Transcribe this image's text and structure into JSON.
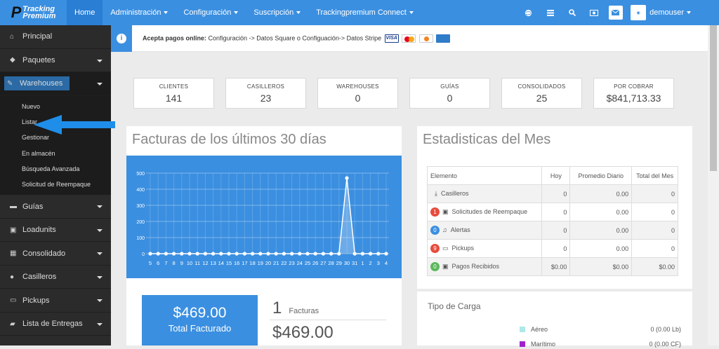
{
  "brand": {
    "line1": "Tracking",
    "line2": "Premium"
  },
  "nav": {
    "items": [
      {
        "label": "Home",
        "active": true,
        "caret": false
      },
      {
        "label": "Administración",
        "caret": true
      },
      {
        "label": "Configuración",
        "caret": true
      },
      {
        "label": "Suscripción",
        "caret": true
      },
      {
        "label": "Trackingpremium Connect",
        "caret": true
      }
    ],
    "icons": [
      "globe-icon",
      "list-icon",
      "search-icon",
      "money-icon",
      "mail-icon"
    ],
    "user": "demouser"
  },
  "sidebar": {
    "items": [
      {
        "label": "Principal",
        "icon": "home-icon",
        "glyph": "⌂",
        "arrow": false
      },
      {
        "label": "Paquetes",
        "icon": "tag-icon",
        "glyph": "◆",
        "arrow": true
      },
      {
        "label": "Warehouses",
        "icon": "edit-icon",
        "glyph": "✎",
        "arrow": true,
        "open": true
      },
      {
        "label": "Guías",
        "icon": "card-icon",
        "glyph": "▬",
        "arrow": true
      },
      {
        "label": "Loadunits",
        "icon": "box-icon",
        "glyph": "▣",
        "arrow": true
      },
      {
        "label": "Consolidado",
        "icon": "table-icon",
        "glyph": "▦",
        "arrow": true
      },
      {
        "label": "Casilleros",
        "icon": "pin-icon",
        "glyph": "●",
        "arrow": true
      },
      {
        "label": "Pickups",
        "icon": "car-icon",
        "glyph": "▭",
        "arrow": true
      },
      {
        "label": "Lista de Entregas",
        "icon": "truck-icon",
        "glyph": "▰",
        "arrow": true
      }
    ],
    "submenu": [
      "Nuevo",
      "Listar",
      "Gestionar",
      "En almacén",
      "Búsqueda Avanzada",
      "Solicitud de Reempaque"
    ]
  },
  "alert": {
    "bold": "Acepta pagos online:",
    "text": " Configuración -> Datos Square o Configuación-> Datos Stripe"
  },
  "stats": [
    {
      "label": "CLIENTES",
      "value": "141"
    },
    {
      "label": "CASILLEROS",
      "value": "23"
    },
    {
      "label": "WAREHOUSES",
      "value": "0"
    },
    {
      "label": "GUÍAS",
      "value": "0"
    },
    {
      "label": "CONSOLIDADOS",
      "value": "25"
    },
    {
      "label": "POR COBRAR",
      "value": "$841,713.33"
    }
  ],
  "invoices": {
    "title": "Facturas de los últimos 30 días",
    "total_amount": "$469.00",
    "total_label": "Total Facturado",
    "count": "1",
    "count_label": "Facturas",
    "amount": "$469.00"
  },
  "chart_data": {
    "type": "line",
    "categories": [
      "5",
      "6",
      "7",
      "8",
      "9",
      "10",
      "11",
      "12",
      "13",
      "14",
      "15",
      "16",
      "17",
      "18",
      "19",
      "20",
      "21",
      "22",
      "23",
      "24",
      "25",
      "26",
      "27",
      "28",
      "29",
      "30",
      "31",
      "1",
      "2",
      "3",
      "4"
    ],
    "values": [
      0,
      0,
      0,
      0,
      0,
      0,
      0,
      0,
      0,
      0,
      0,
      0,
      0,
      0,
      0,
      0,
      0,
      0,
      0,
      0,
      0,
      0,
      0,
      0,
      0,
      469,
      0,
      0,
      0,
      0,
      0
    ],
    "yticks": [
      0,
      100,
      200,
      300,
      400,
      500
    ],
    "ylim": [
      0,
      500
    ],
    "grid": true,
    "colors": {
      "background": "#3b8fe0",
      "line": "#ffffff"
    }
  },
  "stats_month": {
    "title": "Estadisticas del Mes",
    "headers": [
      "Elemento",
      "Hoy",
      "Promedio Diario",
      "Total del Mes"
    ],
    "rows": [
      {
        "label": "Casilleros",
        "badge": "",
        "badge_color": "",
        "icon": "download-icon",
        "glyph": "⤓",
        "hoy": "0",
        "prom": "0.00",
        "total": "0"
      },
      {
        "label": "Solicitudes de Reempaque",
        "badge": "1",
        "badge_color": "#e74c3c",
        "icon": "box-icon",
        "glyph": "▣",
        "hoy": "0",
        "prom": "0.00",
        "total": "0"
      },
      {
        "label": "Alertas",
        "badge": "0",
        "badge_color": "#3b8fe0",
        "icon": "bell-icon",
        "glyph": "♫",
        "hoy": "0",
        "prom": "0.00",
        "total": "0"
      },
      {
        "label": "Pickups",
        "badge": "9",
        "badge_color": "#e74c3c",
        "icon": "car-icon",
        "glyph": "▭",
        "hoy": "0",
        "prom": "0.00",
        "total": "0"
      },
      {
        "label": "Pagos Recibidos",
        "badge": "0",
        "badge_color": "#5cb85c",
        "icon": "money-icon",
        "glyph": "▣",
        "hoy": "$0.00",
        "prom": "$0.00",
        "total": "$0.00"
      }
    ]
  },
  "cargo": {
    "title": "Tipo de Carga",
    "items": [
      {
        "label": "Aéreo",
        "value": "0 (0.00 Lb)",
        "color": "#aee8e8"
      },
      {
        "label": "Marítimo",
        "value": "0 (0.00 CF)",
        "color": "#a020d0"
      }
    ]
  }
}
